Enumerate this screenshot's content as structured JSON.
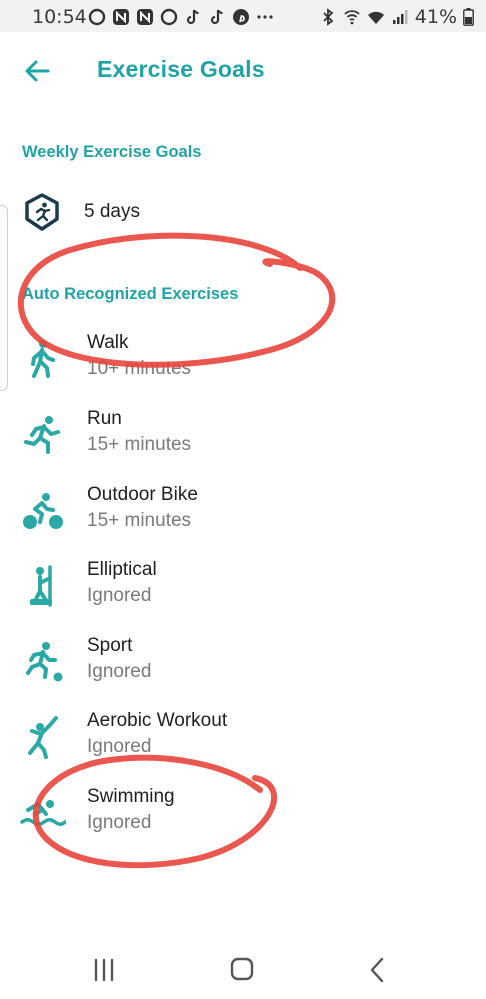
{
  "status_bar": {
    "time": "10:54",
    "battery_percent": "41%",
    "icons": [
      "circle-app-icon",
      "n-app-icon",
      "n-app-icon",
      "circle-app-icon",
      "tiktok-icon",
      "tiktok-icon",
      "pinterest-icon",
      "more-icon",
      "bluetooth-icon",
      "wifi-call-icon",
      "wifi-icon",
      "signal-icon",
      "battery-icon"
    ]
  },
  "header": {
    "title": "Exercise Goals",
    "back_icon": "arrow-left-icon"
  },
  "weekly": {
    "section_label": "Weekly Exercise Goals",
    "value": "5 days",
    "icon": "runner-badge-icon"
  },
  "auto": {
    "section_label": "Auto Recognized Exercises",
    "items": [
      {
        "name": "Walk",
        "value": "10+ minutes",
        "icon": "walk-icon"
      },
      {
        "name": "Run",
        "value": "15+ minutes",
        "icon": "run-icon"
      },
      {
        "name": "Outdoor Bike",
        "value": "15+ minutes",
        "icon": "bike-icon"
      },
      {
        "name": "Elliptical",
        "value": "Ignored",
        "icon": "elliptical-icon"
      },
      {
        "name": "Sport",
        "value": "Ignored",
        "icon": "sport-icon"
      },
      {
        "name": "Aerobic Workout",
        "value": "Ignored",
        "icon": "aerobic-icon"
      },
      {
        "name": "Swimming",
        "value": "Ignored",
        "icon": "swimming-icon"
      }
    ]
  },
  "colors": {
    "accent": "#1fa3a6",
    "badge": "#1b3a4b",
    "annotation": "#e8453c"
  },
  "nav": {
    "icons": [
      "recent-apps-icon",
      "home-icon",
      "back-nav-icon"
    ]
  }
}
